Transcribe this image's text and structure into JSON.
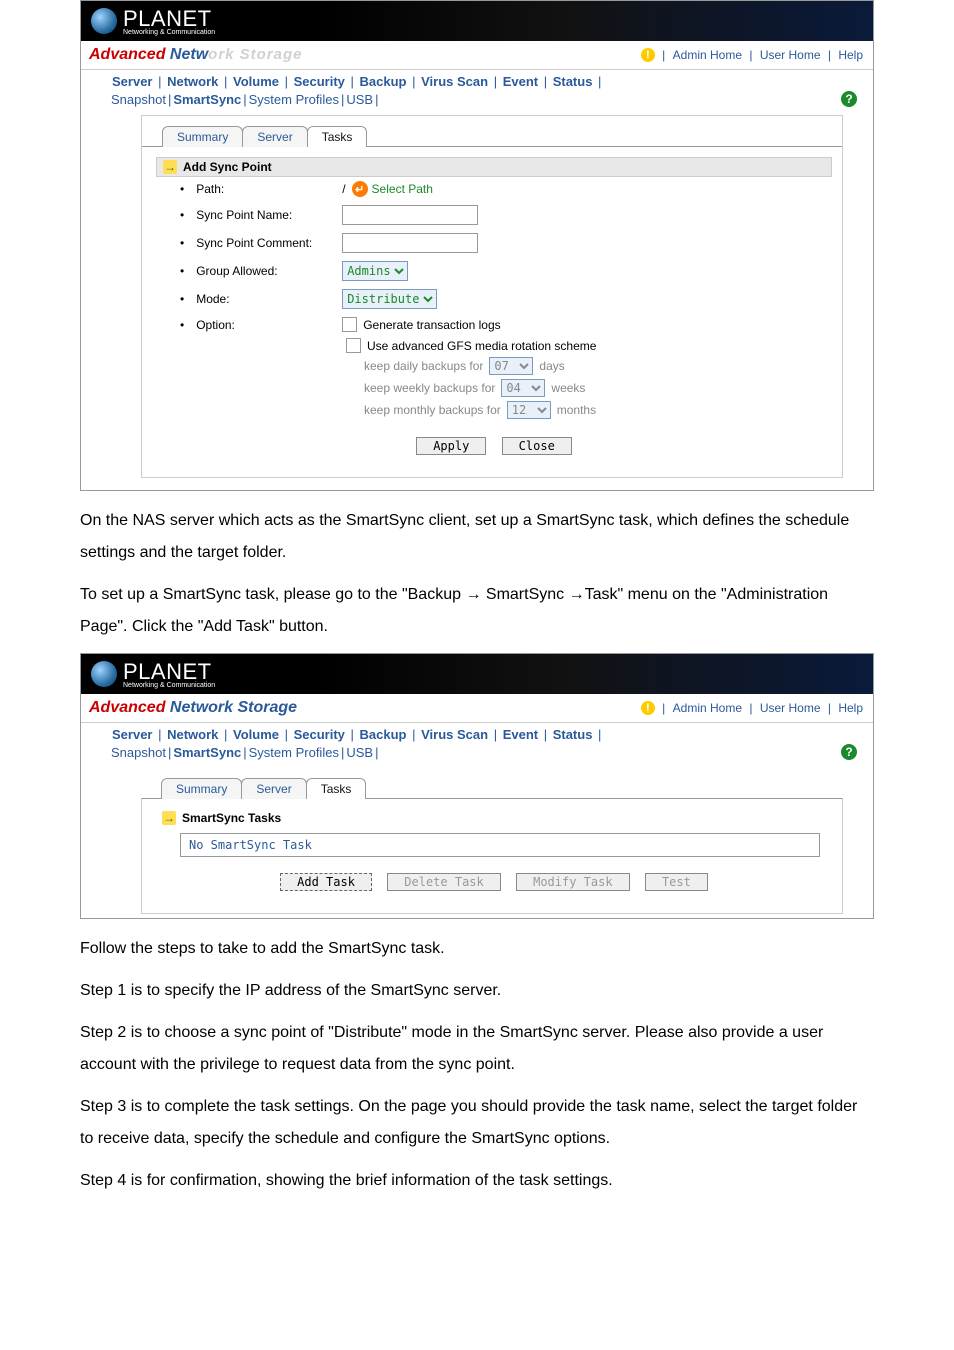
{
  "brand": {
    "name": "PLANET",
    "tagline": "Networking & Communication"
  },
  "title": {
    "prefix": "Advanced ",
    "mid": "Netw",
    "suffix": "ork Storage"
  },
  "header_links": {
    "admin": "Admin Home",
    "user": "User Home",
    "help": "Help"
  },
  "nav1": [
    "Server",
    "Network",
    "Volume",
    "Security",
    "Backup",
    "Virus Scan",
    "Event",
    "Status"
  ],
  "nav2": {
    "items": [
      "Snapshot",
      "SmartSync",
      "System Profiles",
      "USB"
    ],
    "active": "SmartSync"
  },
  "tabs": {
    "summary": "Summary",
    "server": "Server",
    "tasks": "Tasks"
  },
  "shot1": {
    "active_tab": "Tasks",
    "section": "Add Sync Point",
    "rows": {
      "path_label": "Path:",
      "path_prefix": "/",
      "select_path": "Select Path",
      "name_label": "Sync Point Name:",
      "comment_label": "Sync Point Comment:",
      "group_label": "Group Allowed:",
      "group_value": "Admins",
      "mode_label": "Mode:",
      "mode_value": "Distribute",
      "option_label": "Option:",
      "opt_gen_logs": "Generate transaction logs",
      "opt_gfs": "Use advanced GFS media rotation scheme",
      "gfs_daily_pre": "keep daily backups for",
      "gfs_daily_val": "07",
      "gfs_daily_unit": "days",
      "gfs_weekly_pre": "keep weekly backups for",
      "gfs_weekly_val": "04",
      "gfs_weekly_unit": "weeks",
      "gfs_monthly_pre": "keep monthly backups for",
      "gfs_monthly_val": "12",
      "gfs_monthly_unit": "months"
    },
    "buttons": {
      "apply": "Apply",
      "close": "Close"
    }
  },
  "para1": "On the NAS server which acts as the SmartSync client, set up a SmartSync task, which defines the schedule settings and the target folder.",
  "para2": "To set up a SmartSync task, please go to the \"Backup → SmartSync →Task\" menu on the \"Administration Page\". Click the \"Add Task\" button.",
  "shot2": {
    "section": "SmartSync Tasks",
    "msg": "No SmartSync Task",
    "buttons": {
      "add": "Add Task",
      "del": "Delete Task",
      "mod": "Modify Task",
      "test": "Test"
    }
  },
  "para3": "Follow the steps to take to add the SmartSync task.",
  "step1": "Step 1 is to specify the IP address of the SmartSync server.",
  "step2": "Step 2 is to choose a sync point of \"Distribute\" mode in the SmartSync server. Please also provide a user account with the privilege to request data from the sync point.",
  "step3": "Step 3 is to complete the task settings. On the page you should provide the task name, select the target folder to receive data, specify the schedule and configure the SmartSync options.",
  "step4": "Step 4 is for confirmation, showing the brief information of the task settings."
}
